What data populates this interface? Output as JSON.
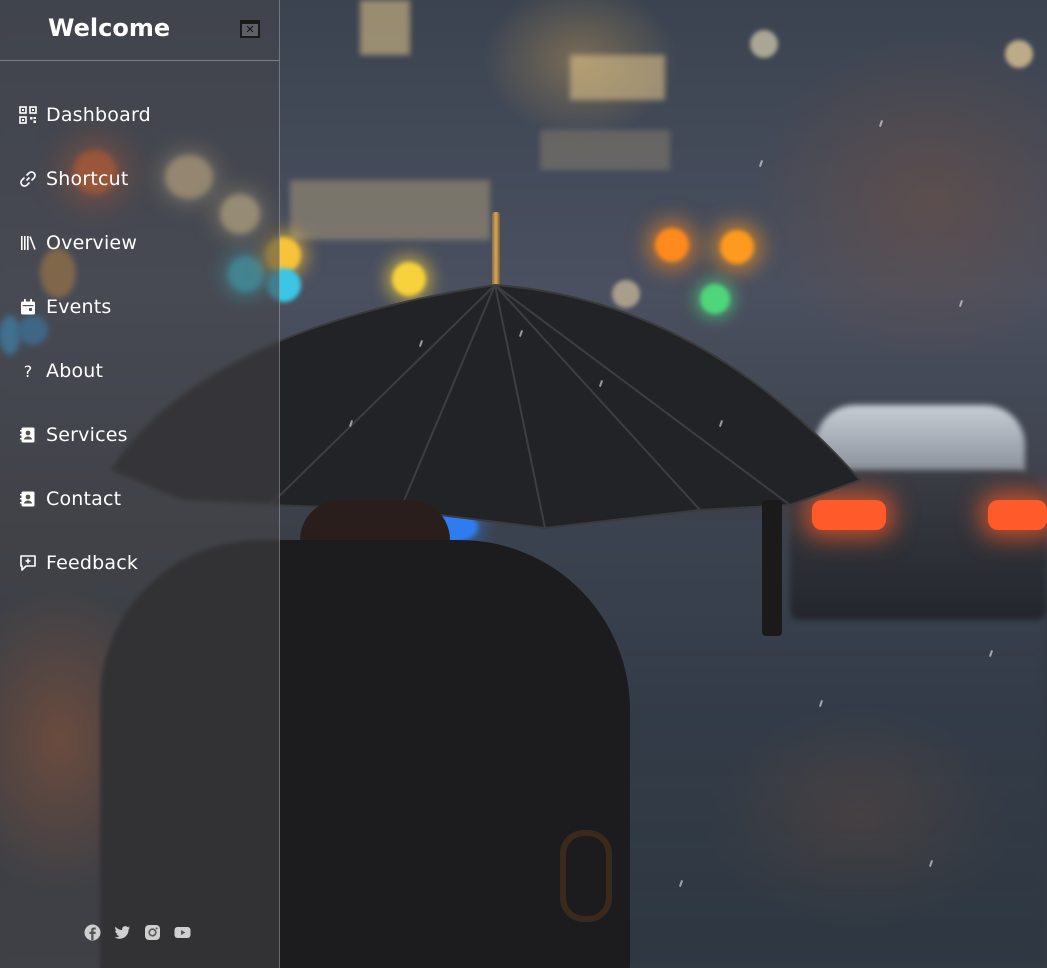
{
  "sidebar": {
    "title": "Welcome",
    "close_icon": "close-icon",
    "items": [
      {
        "label": "Dashboard",
        "icon": "qr-code-icon"
      },
      {
        "label": "Shortcut",
        "icon": "link-icon"
      },
      {
        "label": "Overview",
        "icon": "books-icon"
      },
      {
        "label": "Events",
        "icon": "calendar-icon"
      },
      {
        "label": "About",
        "icon": "question-icon"
      },
      {
        "label": "Services",
        "icon": "contact-book-icon"
      },
      {
        "label": "Contact",
        "icon": "contact-book-icon"
      },
      {
        "label": "Feedback",
        "icon": "comment-plus-icon"
      }
    ],
    "social": [
      "facebook-icon",
      "twitter-icon",
      "instagram-icon",
      "youtube-icon"
    ]
  },
  "background": {
    "description_icon": "rainy-street-umbrella-photo"
  },
  "colors": {
    "sidebar_bg": "#464648",
    "text": "#ffffff",
    "social_icon": "#d0d0d0"
  }
}
